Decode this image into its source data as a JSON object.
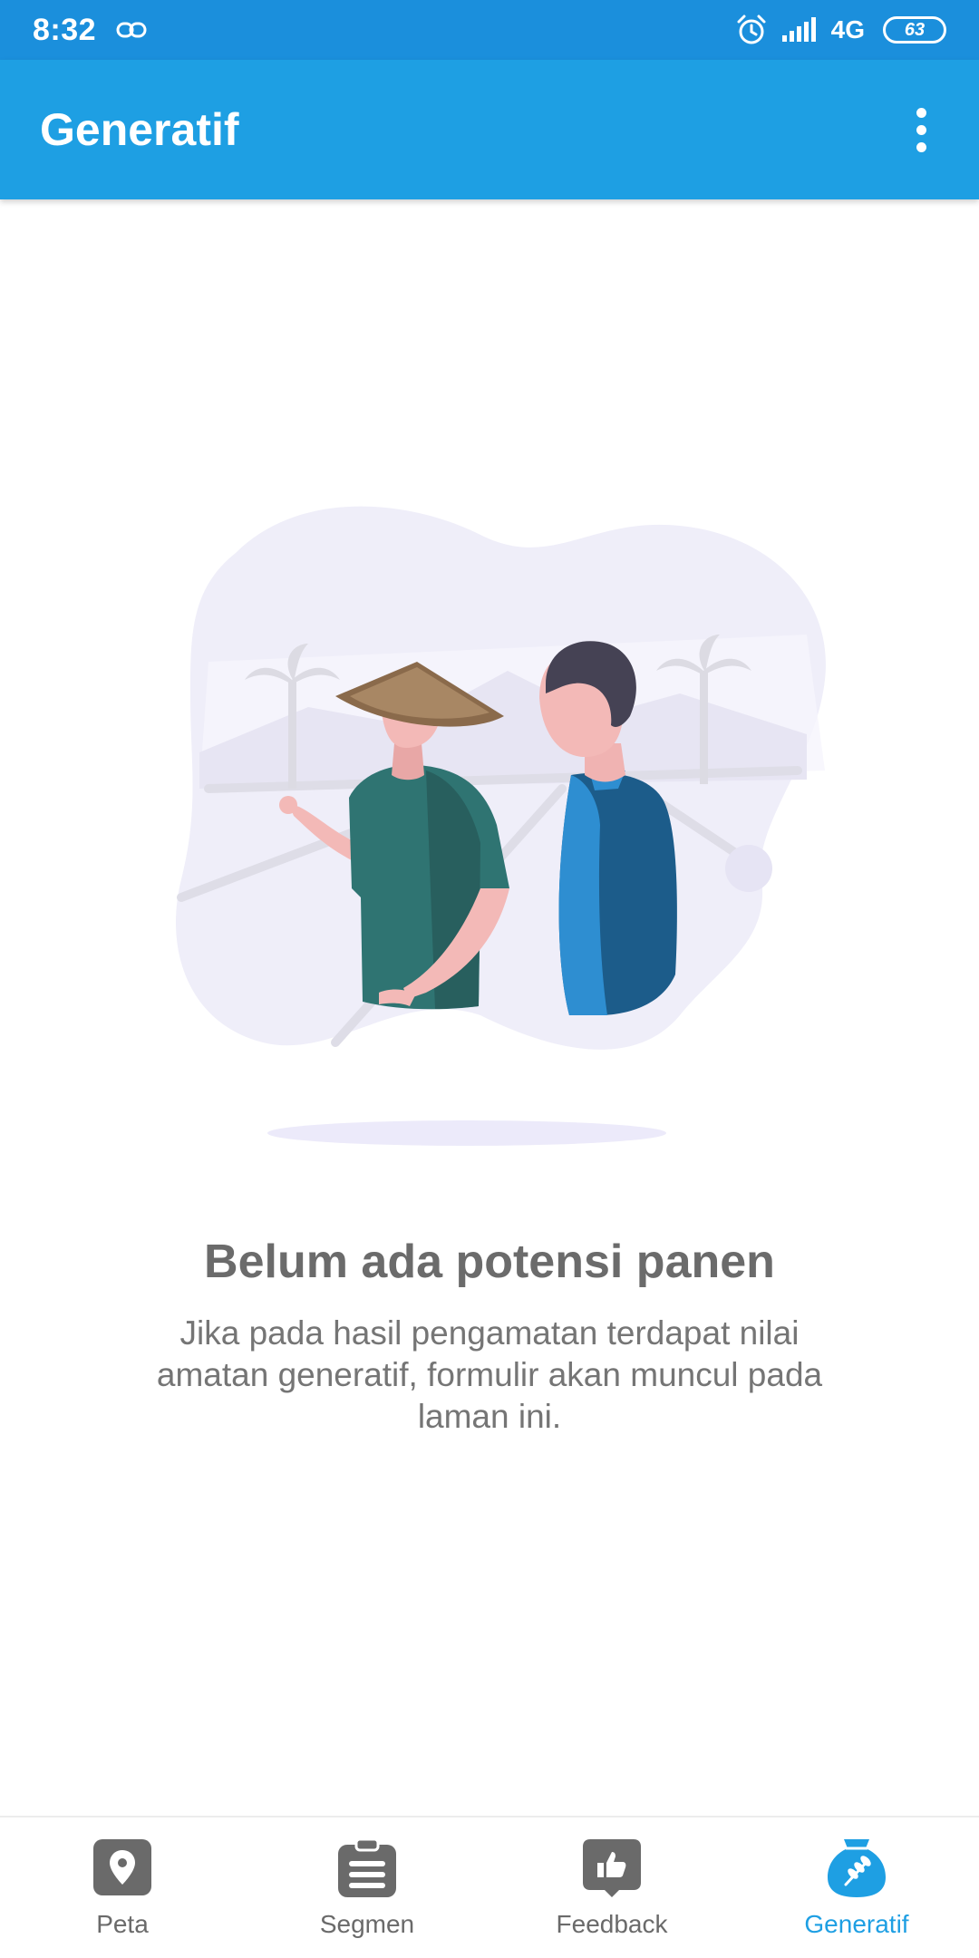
{
  "status_bar": {
    "time": "8:32",
    "network": "4G",
    "battery": "63"
  },
  "app_bar": {
    "title": "Generatif"
  },
  "empty_state": {
    "title": "Belum ada potensi panen",
    "description": "Jika pada hasil pengamatan terdapat nilai amatan generatif, formulir akan muncul pada laman ini."
  },
  "bottom_nav": {
    "items": [
      {
        "label": "Peta",
        "icon": "map-pin-icon",
        "active": false
      },
      {
        "label": "Segmen",
        "icon": "clipboard-list-icon",
        "active": false
      },
      {
        "label": "Feedback",
        "icon": "thumbs-up-icon",
        "active": false
      },
      {
        "label": "Generatif",
        "icon": "grain-sack-icon",
        "active": true
      }
    ]
  },
  "colors": {
    "status_bar": "#1b8fdc",
    "app_bar": "#1e9fe3",
    "active_nav": "#1e9fe3",
    "inactive_nav": "#6a6a6a"
  }
}
